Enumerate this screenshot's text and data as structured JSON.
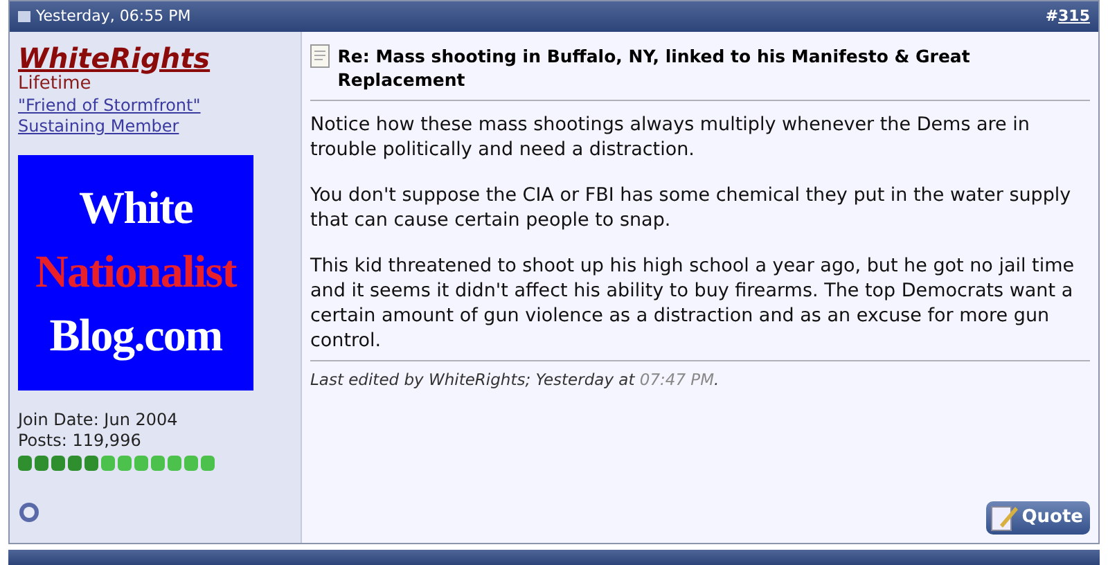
{
  "post_header": {
    "date": "Yesterday, 06:55 PM",
    "number_prefix": "#",
    "number": "315"
  },
  "user": {
    "name": "WhiteRights",
    "title": "Lifetime",
    "badges": [
      "\"Friend of Stormfront\"",
      "Sustaining Member"
    ],
    "avatar": {
      "lines": [
        {
          "text": "White",
          "color": "#ffffff"
        },
        {
          "text": "Nationalist",
          "color": "#e8202a"
        },
        {
          "text": "Blog.com",
          "color": "#ffffff"
        }
      ]
    },
    "join_date": "Join Date: Jun 2004",
    "posts": "Posts: 119,996",
    "reputation": [
      {
        "color": "#2f8f2f"
      },
      {
        "color": "#2f8f2f"
      },
      {
        "color": "#2f8f2f"
      },
      {
        "color": "#2f8f2f"
      },
      {
        "color": "#2f8f2f"
      },
      {
        "color": "#4cc14c"
      },
      {
        "color": "#4cc14c"
      },
      {
        "color": "#4cc14c"
      },
      {
        "color": "#4cc14c"
      },
      {
        "color": "#4cc14c"
      },
      {
        "color": "#4cc14c"
      },
      {
        "color": "#4cc14c"
      }
    ]
  },
  "post": {
    "title": "Re: Mass shooting in Buffalo, NY, linked to his Manifesto & Great Replacement",
    "paragraphs": [
      "Notice how these mass shootings always multiply whenever the Dems are in trouble politically and need a distraction.",
      "You don't suppose the CIA or FBI has some chemical they put in the water supply that can cause certain people to snap.",
      "This kid threatened to shoot up his high school a year ago, but he got no jail time and it seems it didn't affect his ability to buy firearms. The top Democrats want a certain amount of gun violence as a distraction and as an excuse for more gun control."
    ],
    "edit_note": "Last edited by WhiteRights; Yesterday at",
    "edit_time": "07:47 PM",
    "edit_end": ".",
    "quote_button": "Quote"
  }
}
